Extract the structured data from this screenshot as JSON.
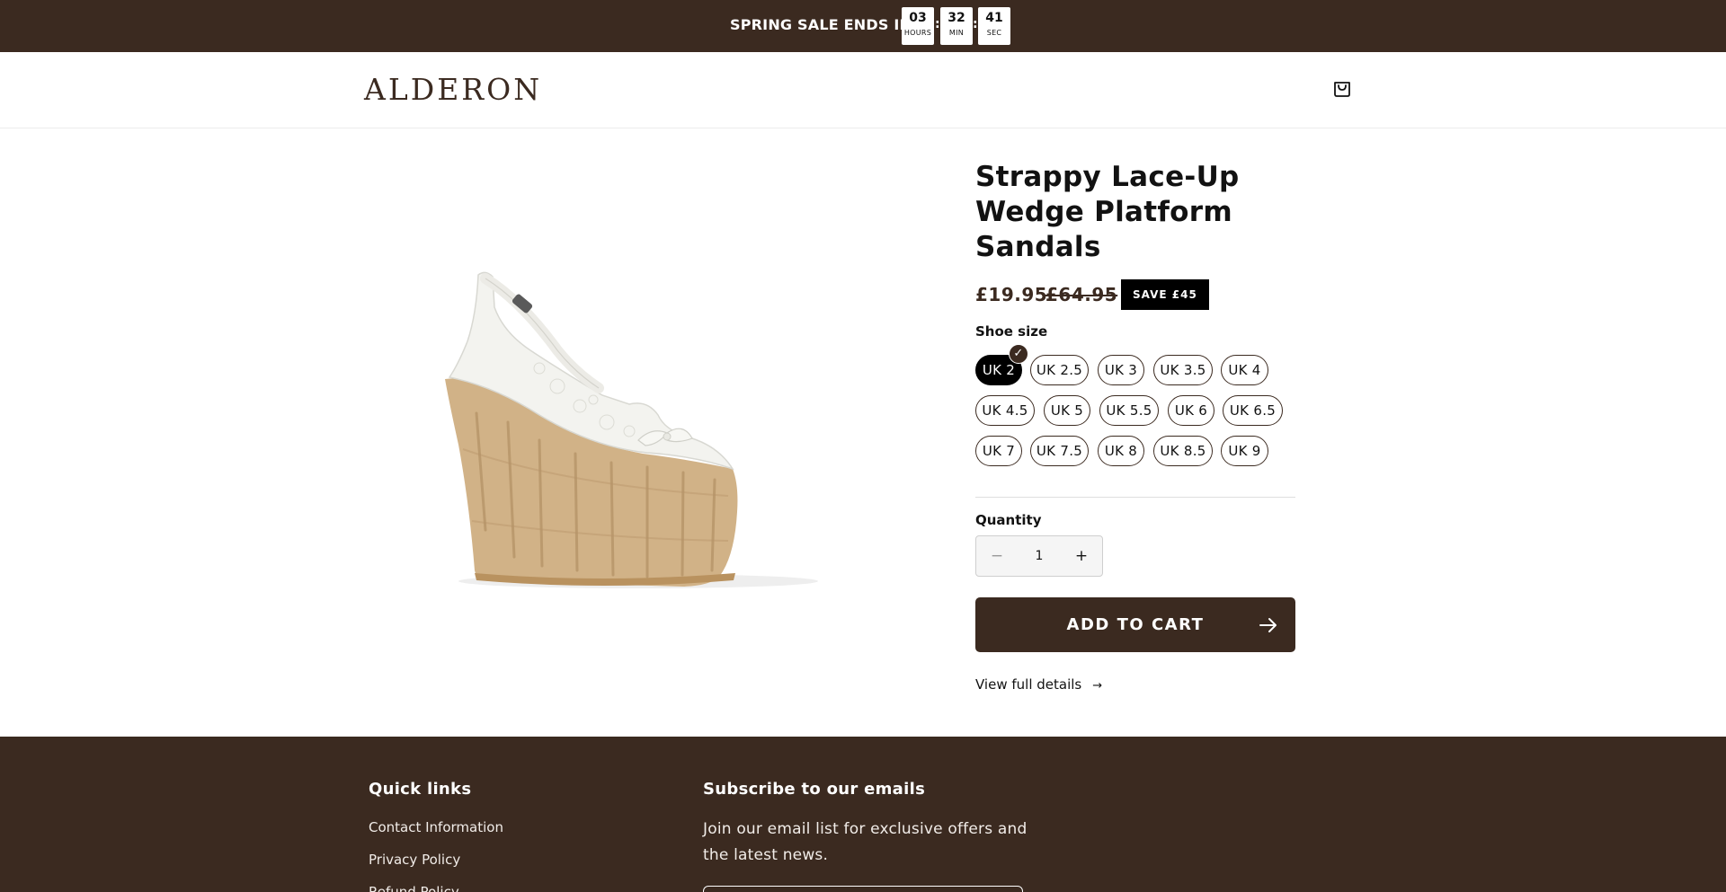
{
  "announcement": {
    "label": "SPRING SALE ENDS IN",
    "timer": [
      {
        "value": "03",
        "unit": "HOURS"
      },
      {
        "value": "32",
        "unit": "MIN"
      },
      {
        "value": "41",
        "unit": "SEC"
      }
    ],
    "separator": ":"
  },
  "header": {
    "logo": "ALDERON",
    "cart_icon": "shopping-bag-icon"
  },
  "product": {
    "image_alt": "White lace slingback cork wedge sandal",
    "title": "Strappy Lace-Up Wedge Platform Sandals",
    "price_sale": "£19.95",
    "price_regular": "£64.95",
    "save_badge": "SAVE £45",
    "size_label": "Shoe size",
    "sizes": [
      "UK 2",
      "UK 2.5",
      "UK 3",
      "UK 3.5",
      "UK 4",
      "UK 4.5",
      "UK 5",
      "UK 5.5",
      "UK 6",
      "UK 6.5",
      "UK 7",
      "UK 7.5",
      "UK 8",
      "UK 8.5",
      "UK 9"
    ],
    "selected_size": "UK 2",
    "check_mark": "✓",
    "quantity_label": "Quantity",
    "quantity_value": "1",
    "quantity_minus": "−",
    "quantity_plus": "+",
    "add_to_cart": "ADD TO CART",
    "view_details": "View full details",
    "view_details_arrow": "→"
  },
  "footer": {
    "quick_links_heading": "Quick links",
    "links": [
      "Contact Information",
      "Privacy Policy",
      "Refund Policy"
    ],
    "subscribe_heading": "Subscribe to our emails",
    "subscribe_text": "Join our email list for exclusive offers and the latest news."
  },
  "colors": {
    "brand": "#3b2a20",
    "accent_dark": "#000000",
    "background": "#ffffff"
  }
}
